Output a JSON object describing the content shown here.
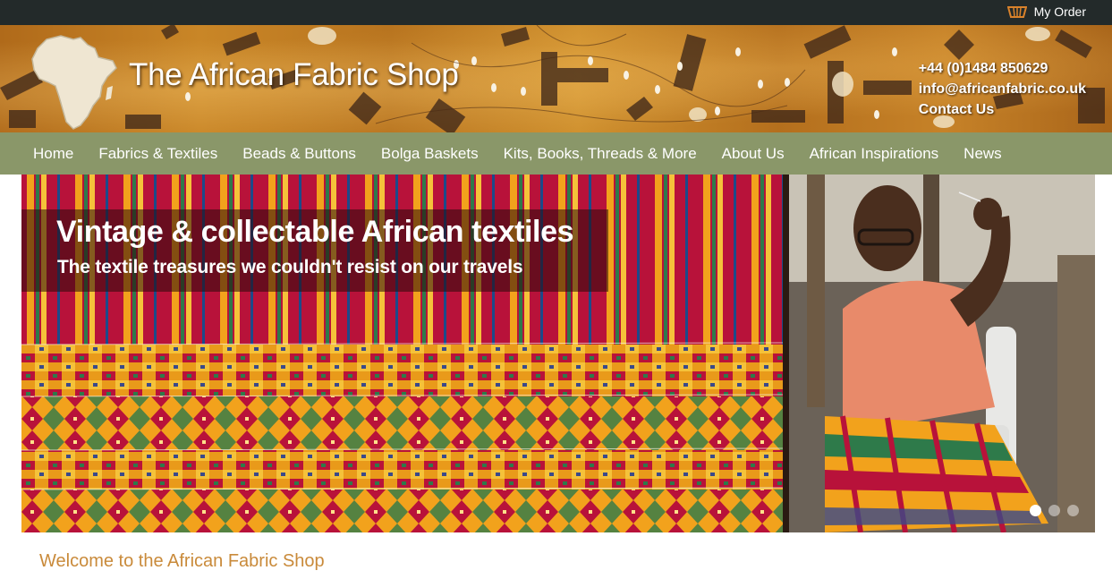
{
  "topbar": {
    "order_label": "My Order",
    "order_icon": "basket-icon"
  },
  "header": {
    "title": "The African Fabric Shop",
    "logo_icon": "africa-map-logo",
    "phone": "+44 (0)1484 850629",
    "email": "info@africanfabric.co.uk",
    "contact": "Contact Us"
  },
  "nav": {
    "items": [
      {
        "label": "Home"
      },
      {
        "label": "Fabrics & Textiles"
      },
      {
        "label": "Beads & Buttons"
      },
      {
        "label": "Bolga Baskets"
      },
      {
        "label": "Kits, Books, Threads & More"
      },
      {
        "label": "About Us"
      },
      {
        "label": "African Inspirations"
      },
      {
        "label": "News"
      }
    ]
  },
  "hero": {
    "title": "Vintage & collectable African textiles",
    "subtitle": "The textile treasures we couldn't resist on our travels",
    "slide_count": 3,
    "active_slide": 1
  },
  "welcome": {
    "heading": "Welcome to the African Fabric Shop"
  },
  "colors": {
    "topbar": "#232a2a",
    "nav": "#8a9769",
    "welcome": "#c98a3a",
    "kente_red": "#b8123a",
    "kente_gold": "#f2a21c"
  }
}
